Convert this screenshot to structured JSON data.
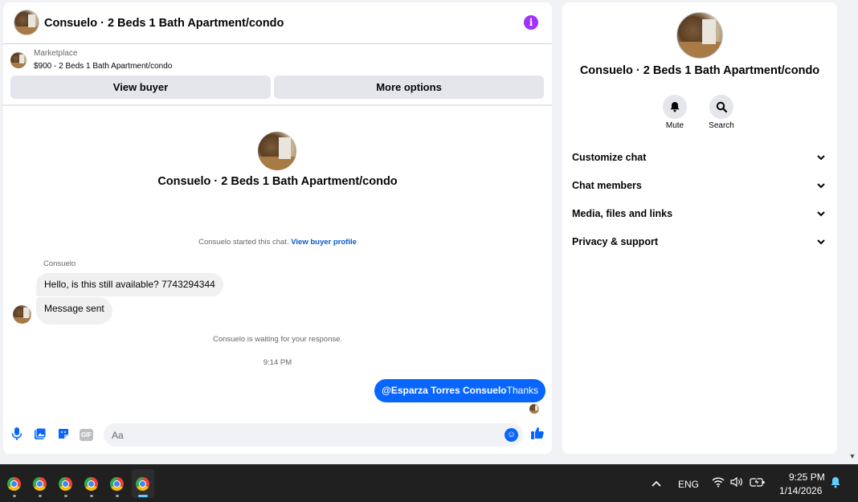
{
  "chat": {
    "title": "Consuelo · 2 Beds 1 Bath Apartment/condo",
    "info_icon": "info-icon",
    "marketplace_label": "Marketplace",
    "listing": "$900 - 2 Beds 1 Bath Apartment/condo",
    "buttons": {
      "view_buyer": "View buyer",
      "more_options": "More options"
    },
    "conversation_title": "Consuelo · 2 Beds 1 Bath Apartment/condo",
    "started_text": "Consuelo started this chat.",
    "view_profile_link": "View buyer profile",
    "sender_name": "Consuelo",
    "messages_in": [
      "Hello, is this still available? 7743294344",
      "Message sent"
    ],
    "waiting_text": "Consuelo is waiting for your response.",
    "timestamp": "9:14 PM",
    "message_out": {
      "mention": "@Esparza Torres Consuelo",
      "text": "Thanks"
    },
    "composer": {
      "placeholder": "Aa",
      "gif_label": "GIF"
    },
    "accent_color": "#0866ff"
  },
  "info_panel": {
    "title": "Consuelo · 2 Beds 1 Bath Apartment/condo",
    "actions": [
      {
        "label": "Mute",
        "icon": "bell-icon"
      },
      {
        "label": "Search",
        "icon": "search-icon"
      }
    ],
    "sections": [
      "Customize chat",
      "Chat members",
      "Media, files and links",
      "Privacy & support"
    ]
  },
  "taskbar": {
    "apps": [
      "chrome-icon",
      "chrome-icon",
      "chrome-icon",
      "chrome-icon",
      "chrome-icon",
      "chrome-icon"
    ],
    "language": "ENG",
    "time": "9:25 PM",
    "date": "1/14/2026"
  }
}
